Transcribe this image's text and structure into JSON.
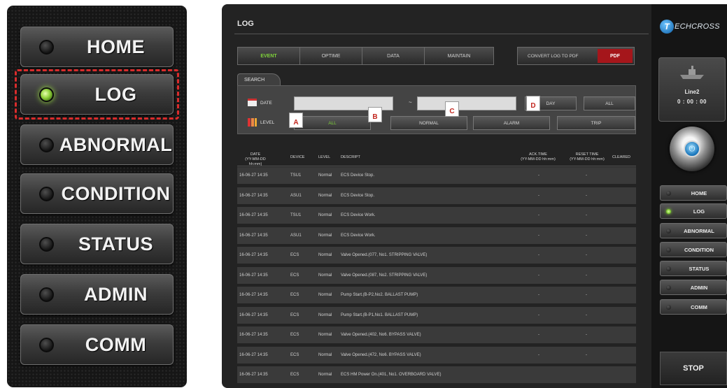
{
  "left_panel": {
    "buttons": [
      {
        "label": "HOME",
        "active": false
      },
      {
        "label": "LOG",
        "active": true
      },
      {
        "label": "ABNORMAL",
        "active": false
      },
      {
        "label": "CONDITION",
        "active": false
      },
      {
        "label": "STATUS",
        "active": false
      },
      {
        "label": "ADMIN",
        "active": false
      },
      {
        "label": "COMM",
        "active": false
      }
    ]
  },
  "main": {
    "title": "LOG",
    "tabs": [
      "EVENT",
      "OPTIME",
      "DATA",
      "MAINTAIN"
    ],
    "active_tab": "EVENT",
    "convert_button": "CONVERT LOG TO PDF",
    "pdf_label": "PDF",
    "search": {
      "tab_label": "SEARCH",
      "date_label": "DATE",
      "date_separator": "~",
      "level_label": "LEVEL",
      "date_buttons": [
        "DAY",
        "ALL"
      ],
      "level_buttons": [
        "ALL",
        "NORMAL",
        "ALARM",
        "TRIP"
      ],
      "markers": [
        "A",
        "B",
        "C",
        "D"
      ]
    },
    "table": {
      "headers": {
        "date": "DATE",
        "date_sub": "(YY-MM-DD hh:mm)",
        "device": "DEVICE",
        "level": "LEVEL",
        "description": "DESCRIPT",
        "ack_time": "ACK.TIME",
        "ack_time_sub": "(YY-MM-DD hh:mm)",
        "reset_time": "RESET TIME",
        "reset_time_sub": "(YY-MM-DD hh:mm)",
        "cleared": "CLEARED"
      },
      "rows": [
        {
          "date": "16-06-27 14:35",
          "device": "TSU1",
          "level": "Normal",
          "desc": "ECS Device Stop.",
          "ack": "-",
          "reset": "-"
        },
        {
          "date": "16-06-27 14:35",
          "device": "ASU1",
          "level": "Normal",
          "desc": "ECS Device Stop.",
          "ack": "-",
          "reset": "-"
        },
        {
          "date": "16-06-27 14:35",
          "device": "TSU1",
          "level": "Normal",
          "desc": "ECS Device Work.",
          "ack": "-",
          "reset": "-"
        },
        {
          "date": "16-06-27 14:35",
          "device": "ASU1",
          "level": "Normal",
          "desc": "ECS Device Work.",
          "ack": "-",
          "reset": "-"
        },
        {
          "date": "16-06-27 14:35",
          "device": "ECS",
          "level": "Normal",
          "desc": "Valve Opened.(077, No1. STRIPPING VALVE)",
          "ack": "-",
          "reset": "-"
        },
        {
          "date": "16-06-27 14:35",
          "device": "ECS",
          "level": "Normal",
          "desc": "Valve Opened.(087, No2. STRIPPING VALVE)",
          "ack": "-",
          "reset": "-"
        },
        {
          "date": "16-06-27 14:35",
          "device": "ECS",
          "level": "Normal",
          "desc": "Pump Start.(B-P2,No2. BALLAST PUMP)",
          "ack": "-",
          "reset": "-"
        },
        {
          "date": "16-06-27 14:35",
          "device": "ECS",
          "level": "Normal",
          "desc": "Pump Start.(B-P1,No1. BALLAST PUMP)",
          "ack": "-",
          "reset": "-"
        },
        {
          "date": "16-06-27 14:35",
          "device": "ECS",
          "level": "Normal",
          "desc": "Valve Opened.(402, No6. BYPASS VALVE)",
          "ack": "-",
          "reset": "-"
        },
        {
          "date": "16-06-27 14:35",
          "device": "ECS",
          "level": "Normal",
          "desc": "Valve Opened.(472, No6. BYPASS VALVE)",
          "ack": "-",
          "reset": "-"
        },
        {
          "date": "16-06-27 14:35",
          "device": "ECS",
          "level": "Normal",
          "desc": "ECS HM Power On.(401, No1. OVERBOARD VALVE)",
          "ack": "",
          "reset": ""
        }
      ]
    }
  },
  "sidebar": {
    "logo_letter": "T",
    "logo_text": "ECHCROSS",
    "line_name": "Line2",
    "line_time": "0 : 00 : 00",
    "power_icon": "⏻",
    "buttons": [
      {
        "label": "HOME",
        "active": false
      },
      {
        "label": "LOG",
        "active": true
      },
      {
        "label": "ABNORMAL",
        "active": false
      },
      {
        "label": "CONDITION",
        "active": false
      },
      {
        "label": "STATUS",
        "active": false
      },
      {
        "label": "ADMIN",
        "active": false
      },
      {
        "label": "COMM",
        "active": false
      }
    ],
    "stop_label": "STOP"
  }
}
